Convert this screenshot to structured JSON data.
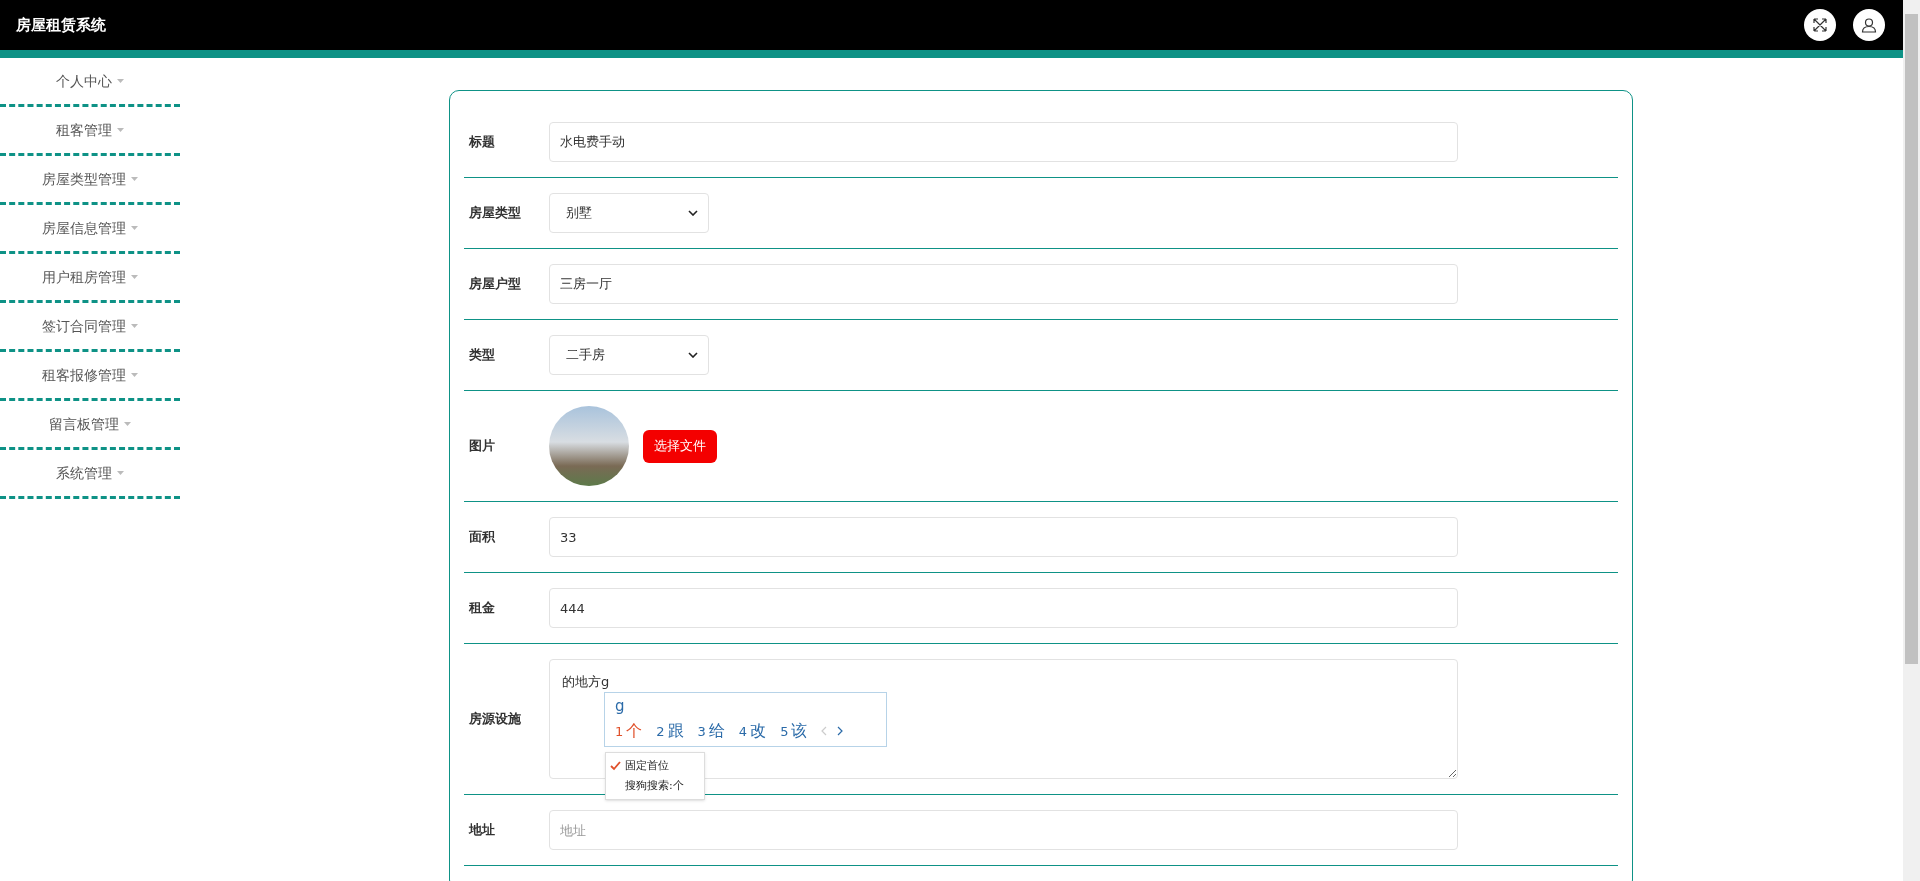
{
  "header": {
    "title": "房屋租赁系统"
  },
  "sidebar": {
    "items": [
      {
        "label": "个人中心"
      },
      {
        "label": "租客管理"
      },
      {
        "label": "房屋类型管理"
      },
      {
        "label": "房屋信息管理"
      },
      {
        "label": "用户租房管理"
      },
      {
        "label": "签订合同管理"
      },
      {
        "label": "租客报修管理"
      },
      {
        "label": "留言板管理"
      },
      {
        "label": "系统管理"
      }
    ]
  },
  "form": {
    "fields": [
      {
        "kind": "text",
        "label": "标题",
        "value": "水电费手动"
      },
      {
        "kind": "select",
        "label": "房屋类型",
        "value": "别墅"
      },
      {
        "kind": "text",
        "label": "房屋户型",
        "value": "三房一厅"
      },
      {
        "kind": "select",
        "label": "类型",
        "value": "二手房"
      },
      {
        "kind": "image",
        "label": "图片",
        "button": "选择文件"
      },
      {
        "kind": "text",
        "label": "面积",
        "value": "33"
      },
      {
        "kind": "text",
        "label": "租金",
        "value": "444"
      },
      {
        "kind": "textarea",
        "label": "房源设施",
        "value": "的地方g"
      },
      {
        "kind": "text",
        "label": "地址",
        "placeholder": "地址"
      }
    ]
  },
  "ime": {
    "composition": "g",
    "candidates": [
      {
        "index": "1",
        "text": "个",
        "selected": true
      },
      {
        "index": "2",
        "text": "跟",
        "selected": false
      },
      {
        "index": "3",
        "text": "给",
        "selected": false
      },
      {
        "index": "4",
        "text": "改",
        "selected": false
      },
      {
        "index": "5",
        "text": "该",
        "selected": false
      }
    ],
    "menu": [
      {
        "label": "固定首位",
        "checked": true
      },
      {
        "label": "搜狗搜索:个",
        "checked": false
      }
    ]
  }
}
